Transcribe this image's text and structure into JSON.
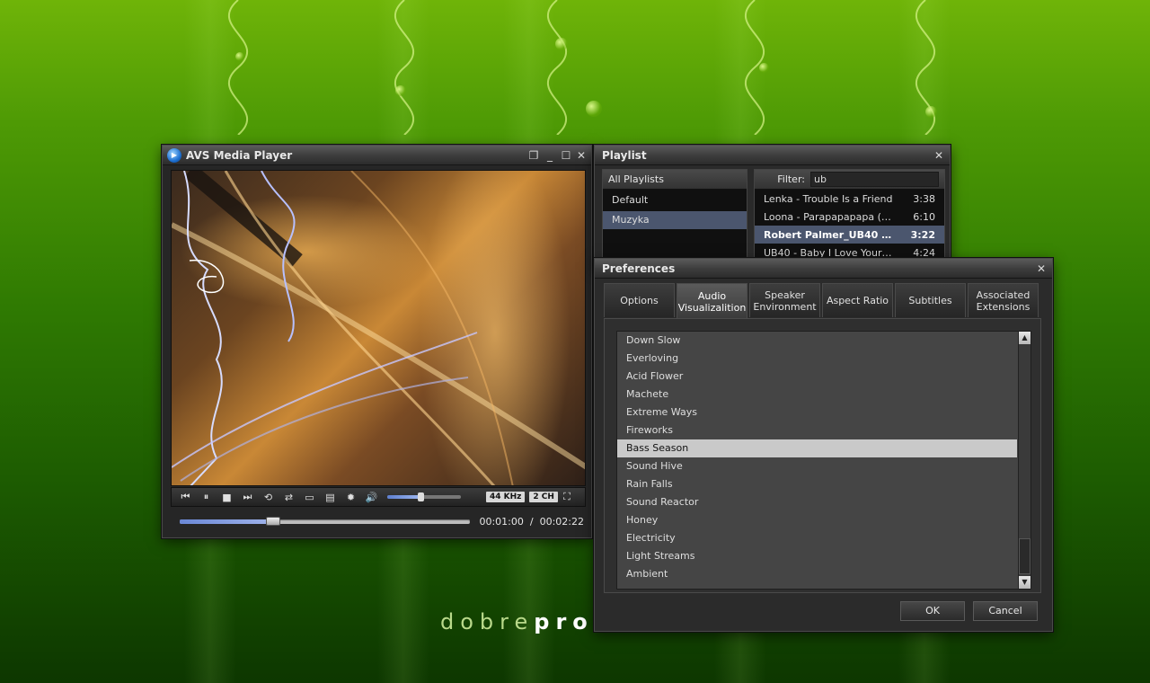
{
  "wallpaper": {
    "logo_light": "dobre",
    "logo_bold": "pro"
  },
  "player": {
    "title": "AVS Media Player",
    "sample_rate": "44 KHz",
    "channels": "2 CH",
    "current_time": "00:01:00",
    "time_separator": "/",
    "total_time": "00:02:22",
    "progress": 0.32,
    "volume": 0.45
  },
  "playlist": {
    "title": "Playlist",
    "left_header": "All Playlists",
    "lists": [
      {
        "label": "Default",
        "selected": false
      },
      {
        "label": "Muzyka",
        "selected": true
      }
    ],
    "filter_label": "Filter:",
    "filter_value": "ub",
    "tracks": [
      {
        "name": "Lenka - Trouble Is a Friend",
        "duration": "3:38",
        "selected": false
      },
      {
        "name": "Loona - Parapapapapa (…",
        "duration": "6:10",
        "selected": false
      },
      {
        "name": "Robert Palmer_UB40 …",
        "duration": "3:22",
        "selected": true
      },
      {
        "name": "UB40 - Baby I Love Your…",
        "duration": "4:24",
        "selected": false
      }
    ]
  },
  "preferences": {
    "title": "Preferences",
    "tabs": [
      {
        "l1": "Options",
        "l2": ""
      },
      {
        "l1": "Audio",
        "l2": "Visualizalition"
      },
      {
        "l1": "Speaker",
        "l2": "Environment"
      },
      {
        "l1": "Aspect Ratio",
        "l2": ""
      },
      {
        "l1": "Subtitles",
        "l2": ""
      },
      {
        "l1": "Associated",
        "l2": "Extensions"
      }
    ],
    "visualizations": [
      "Down Slow",
      "Everloving",
      "Acid Flower",
      "Machete",
      "Extreme Ways",
      "Fireworks",
      "Bass Season",
      "Sound  Hive",
      "Rain Falls",
      "Sound Reactor",
      "Honey",
      "Electricity",
      "Light Streams",
      "Ambient"
    ],
    "selected_visualization": "Bass Season",
    "ok_label": "OK",
    "cancel_label": "Cancel"
  },
  "colors": {
    "selection": "#4b566e",
    "accent_blue": "#6b88d6",
    "list_selected": "#c9c9c9"
  },
  "icons": {
    "prev": "⏮",
    "pause": "⏸",
    "stop": "■",
    "next": "⏭",
    "repeat": "⟲",
    "shuffle": "⇄",
    "aspect": "▭",
    "playlist": "▤",
    "effects": "✹",
    "volume": "🔊",
    "fullscreen": "⛶",
    "restore": "❐",
    "maximize": "☐",
    "close": "✕",
    "scroll_up": "▲",
    "scroll_down": "▼"
  }
}
